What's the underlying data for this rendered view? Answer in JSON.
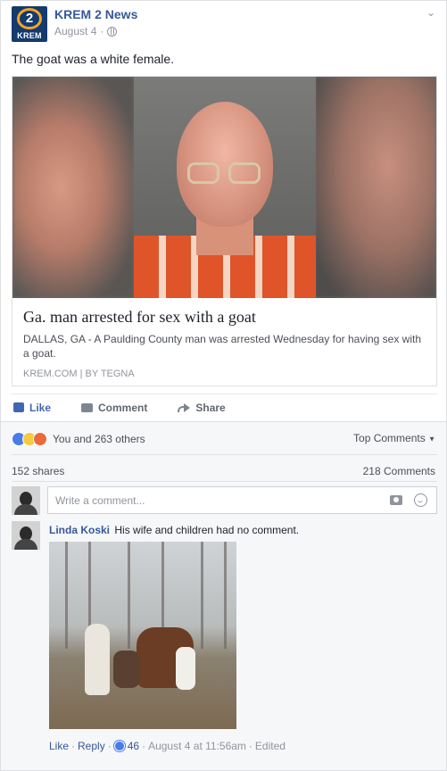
{
  "post": {
    "page_name": "KREM 2 News",
    "page_logo": {
      "number": "2",
      "text": "KREM"
    },
    "date": "August 4",
    "separator": "·",
    "text": "The goat was a white female.",
    "link": {
      "title": "Ga. man arrested for sex with a goat",
      "description": "DALLAS, GA - A Paulding County man was arrested Wednesday for having sex with a goat.",
      "source": "KREM.COM",
      "source_sep": "|",
      "byline": "BY TEGNA"
    },
    "actions": {
      "like": "Like",
      "comment": "Comment",
      "share": "Share"
    }
  },
  "engagement": {
    "reactions_text": "You and 263 others",
    "top_comments_label": "Top Comments",
    "shares": "152 shares",
    "comments": "218 Comments"
  },
  "composer": {
    "placeholder": "Write a comment..."
  },
  "comment": {
    "author": "Linda Koski",
    "text": "His wife and children had no comment.",
    "like_label": "Like",
    "reply_label": "Reply",
    "dot": "·",
    "like_count": "46",
    "timestamp": "August 4 at 11:56am",
    "edited_label": "Edited"
  },
  "colors": {
    "link_blue": "#365899",
    "like_blue": "#4267b2",
    "meta_gray": "#90949c",
    "logo_navy": "#143a6e",
    "logo_orange": "#f4a32a"
  },
  "icons": [
    "globe-icon",
    "chevron-down-icon",
    "like-thumb-icon",
    "comment-bubble-icon",
    "share-arrow-icon",
    "like-reaction-icon",
    "haha-reaction-icon",
    "angry-reaction-icon",
    "camera-icon",
    "emoji-icon"
  ]
}
